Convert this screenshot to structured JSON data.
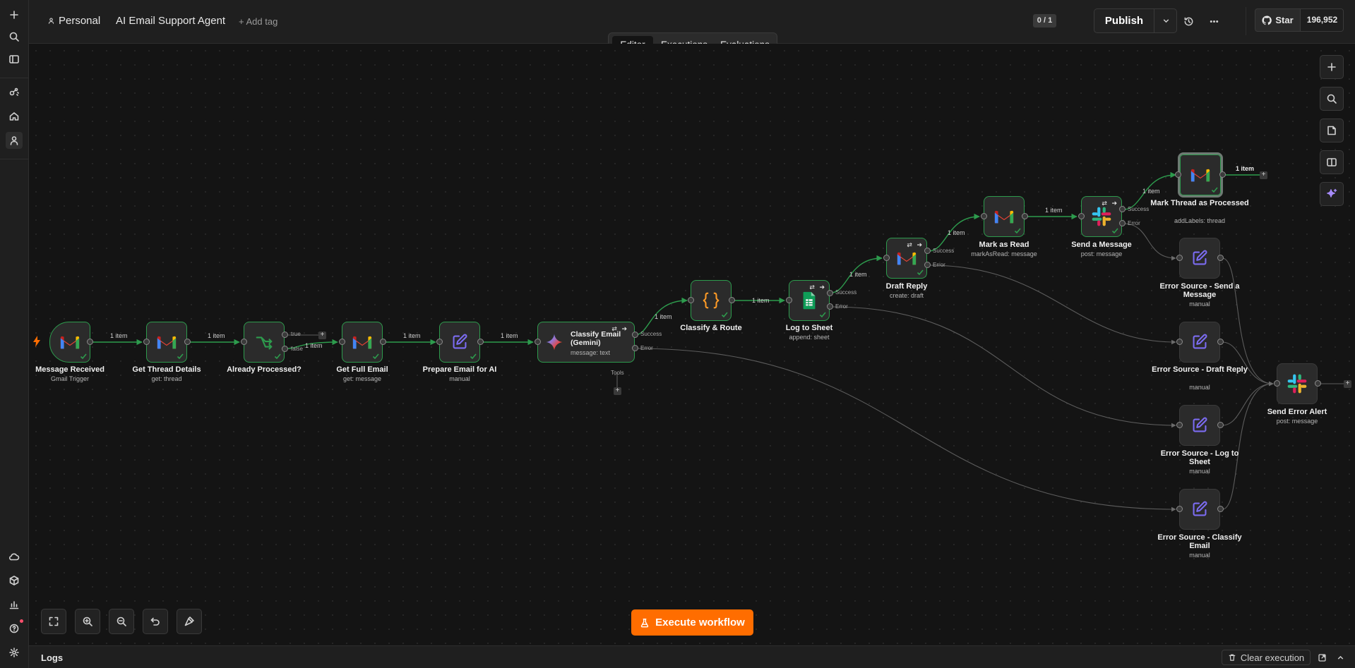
{
  "header": {
    "project": "Personal",
    "workflow_name": "AI Email Support Agent",
    "add_tag": "+ Add tag",
    "counter": "0 / 1",
    "publish_label": "Publish",
    "github_star": "Star",
    "github_count": "196,952"
  },
  "tabs": [
    {
      "label": "Editor",
      "active": true
    },
    {
      "label": "Executions",
      "active": false
    },
    {
      "label": "Evaluations",
      "active": false
    }
  ],
  "nodes": {
    "message_received": {
      "title": "Message Received",
      "sub": "Gmail Trigger"
    },
    "get_thread": {
      "title": "Get Thread Details",
      "sub": "get: thread"
    },
    "already_processed": {
      "title": "Already Processed?",
      "sub": ""
    },
    "get_full_email": {
      "title": "Get Full Email",
      "sub": "get: message"
    },
    "prepare_email": {
      "title": "Prepare Email for AI",
      "sub": "manual"
    },
    "classify_email": {
      "title": "Classify Email (Gemini)",
      "sub": "message: text"
    },
    "classify_route": {
      "title": "Classify & Route",
      "sub": ""
    },
    "log_to_sheet": {
      "title": "Log to Sheet",
      "sub": "append: sheet"
    },
    "draft_reply": {
      "title": "Draft Reply",
      "sub": "create: draft"
    },
    "mark_as_read": {
      "title": "Mark as Read",
      "sub": "markAsRead: message"
    },
    "send_message": {
      "title": "Send a Message",
      "sub": "post: message"
    },
    "mark_thread": {
      "title": "Mark Thread as Processed",
      "sub": "addLabels: thread"
    },
    "err_send": {
      "title": "Error Source - Send a Message",
      "sub": "manual"
    },
    "err_draft": {
      "title": "Error Source - Draft Reply",
      "sub": "manual"
    },
    "err_log": {
      "title": "Error Source - Log to Sheet",
      "sub": "manual"
    },
    "err_classify": {
      "title": "Error Source - Classify Email",
      "sub": "manual"
    },
    "send_error_alert": {
      "title": "Send Error Alert",
      "sub": "post: message"
    }
  },
  "edge_labels": {
    "item": "1 item",
    "true": "true",
    "false": "false",
    "success": "Success",
    "error": "Error",
    "tools": "Tools"
  },
  "execute_label": "Execute workflow",
  "logs": {
    "label": "Logs",
    "clear": "Clear execution"
  },
  "colors": {
    "accent": "#ff6d00",
    "success": "#2d9b4d",
    "edge_success": "#2d9b4d",
    "edge_error": "#6b6b6b",
    "gmail_red": "#ea4335",
    "sheets_green": "#0f9d58",
    "edit_purple": "#7c6cf2"
  }
}
